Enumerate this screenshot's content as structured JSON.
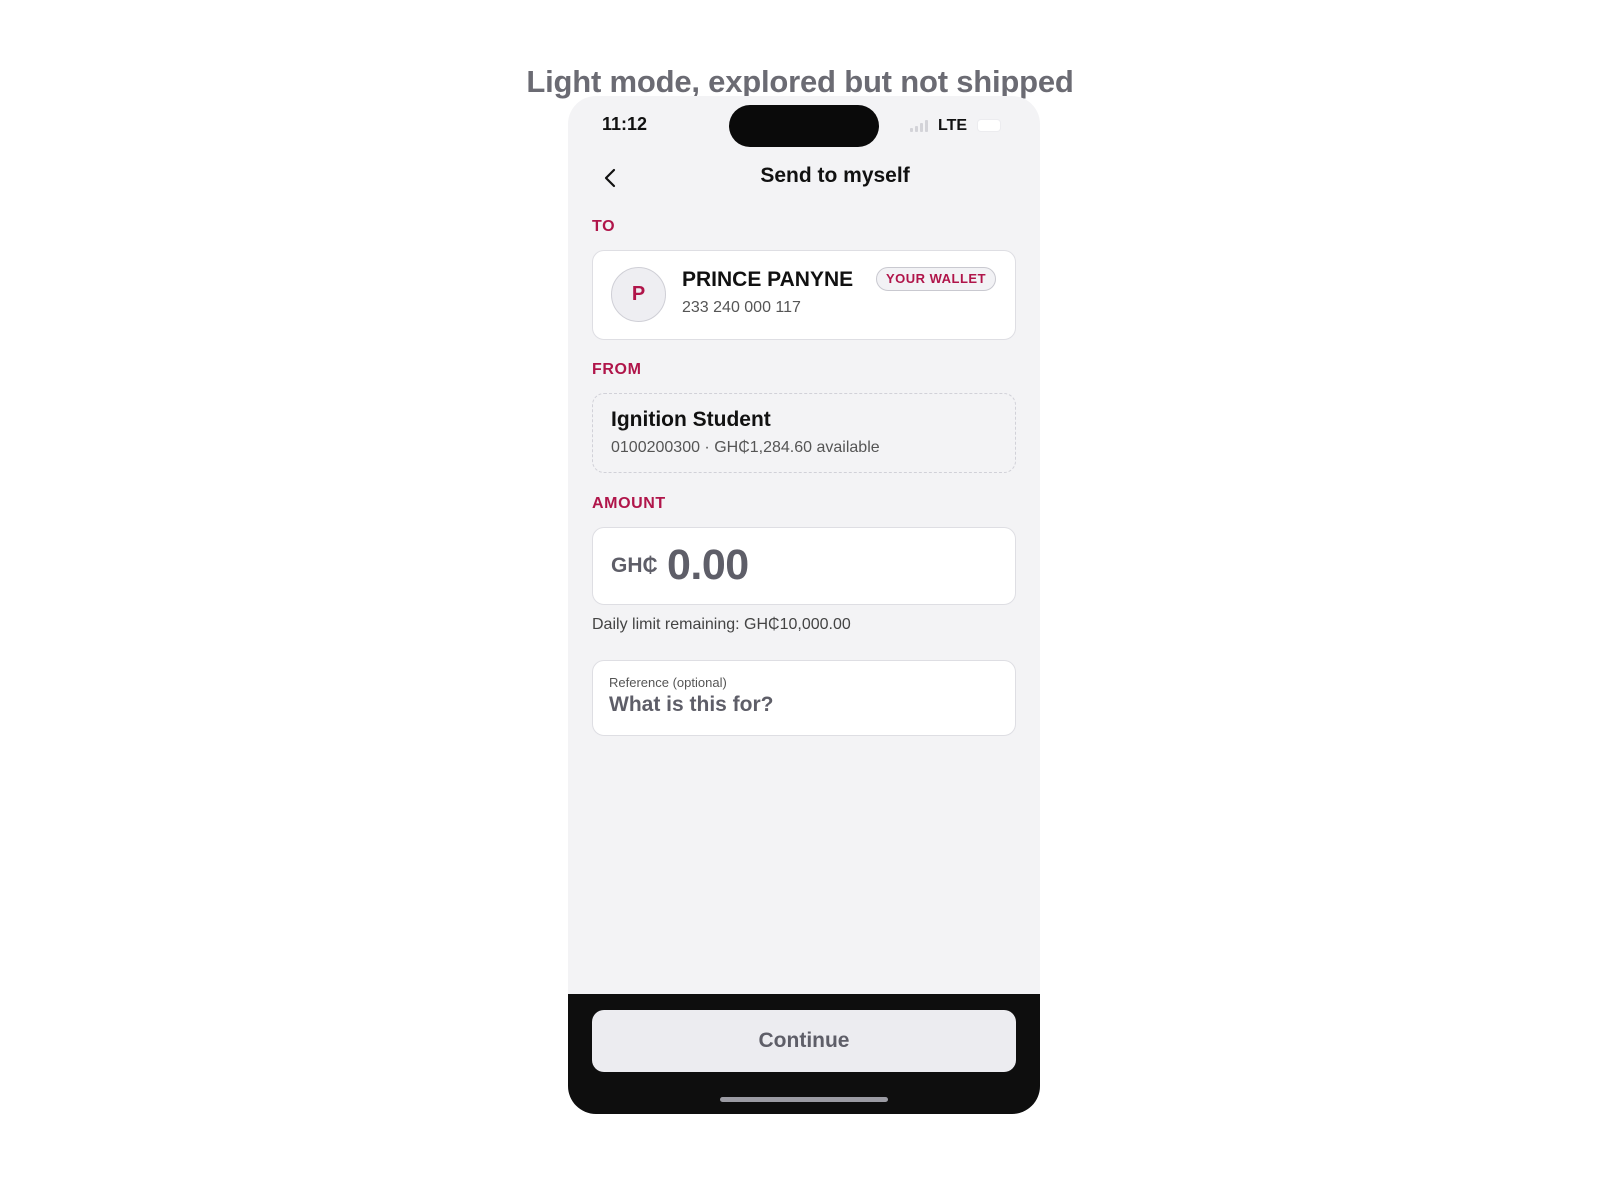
{
  "caption": "Light mode, explored but not shipped",
  "status_bar": {
    "time": "11:12",
    "network": "LTE",
    "icons": [
      "signal-icon",
      "battery-icon"
    ]
  },
  "header": {
    "back_icon": "chevron-left-icon",
    "title": "Send to myself"
  },
  "to_section": {
    "label": "TO",
    "avatar_initial": "P",
    "name": "PRINCE PANYNE",
    "phone": "233 240 000 117",
    "badge": "YOUR WALLET"
  },
  "from_section": {
    "label": "FROM",
    "account_name": "Ignition Student",
    "account_detail": "0100200300 · GH₵1,284.60 available"
  },
  "amount_section": {
    "label": "AMOUNT",
    "currency": "GH₵",
    "value": "0.00",
    "daily_limit": "Daily limit remaining: GH₵10,000.00"
  },
  "reference": {
    "label": "Reference (optional)",
    "placeholder": "What is this for?",
    "value": ""
  },
  "footer": {
    "continue_label": "Continue"
  },
  "colors": {
    "accent": "#b0154a",
    "screen_background": "#f3f3f5",
    "footer_background": "#0e0e0e",
    "disabled_button": "#ececf0"
  }
}
